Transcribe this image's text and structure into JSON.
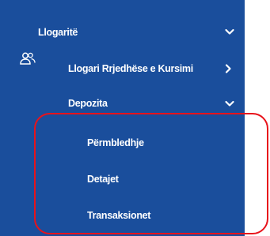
{
  "menu": {
    "accounts": {
      "label": "Llogaritë",
      "icon": "users-icon",
      "chevron": "chevron-down"
    },
    "current_savings": {
      "label": "Llogari Rrjedhëse e Kursimi",
      "chevron": "chevron-right"
    },
    "deposits": {
      "label": "Depozita",
      "chevron": "chevron-down",
      "children": [
        {
          "label": "Përmbledhje"
        },
        {
          "label": "Detajet"
        },
        {
          "label": "Transaksionet"
        }
      ]
    }
  },
  "colors": {
    "nav_background": "#1a4e9c",
    "text": "#ffffff",
    "highlight": "#e8131b"
  }
}
